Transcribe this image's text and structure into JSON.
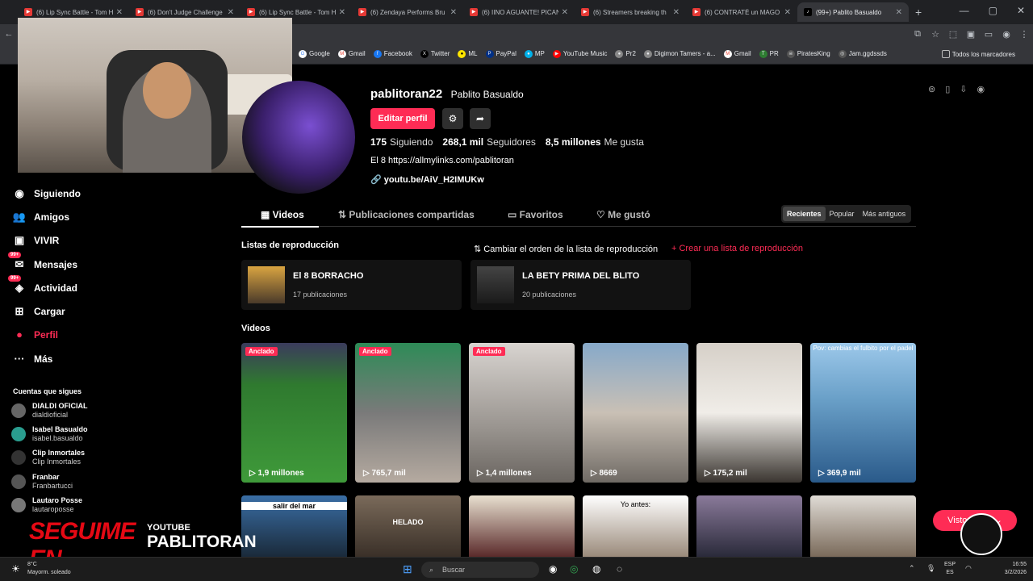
{
  "browser": {
    "tabs": [
      {
        "title": "(6) Lip Sync Battle - Tom H"
      },
      {
        "title": "(6) Don't Judge Challenge"
      },
      {
        "title": "(6) Lip Sync Battle - Tom H"
      },
      {
        "title": "(6) Zendaya Performs Bru"
      },
      {
        "title": "(6) IINO AGUANTE! PICAN"
      },
      {
        "title": "(6) Streamers breaking th"
      },
      {
        "title": "(6) CONTRATÉ un MAGO"
      },
      {
        "title": "(99+) Pablito Basualdo"
      }
    ],
    "bookmarks": [
      "Google",
      "Gmail",
      "Facebook",
      "Twitter",
      "ML",
      "PayPal",
      "MP",
      "YouTube Music",
      "Pr2",
      "Digimon Tamers - a...",
      "Gmail",
      "PR",
      "PiratesKing",
      "Jam.ggdssds"
    ],
    "all_bookmarks": "Todos los marcadores"
  },
  "sidebar": {
    "items": [
      {
        "label": "Siguiendo",
        "icon": "following-icon",
        "badge": ""
      },
      {
        "label": "Amigos",
        "icon": "friends-icon",
        "badge": ""
      },
      {
        "label": "VIVIR",
        "icon": "live-icon",
        "badge": ""
      },
      {
        "label": "Mensajes",
        "icon": "messages-icon",
        "badge": "99+"
      },
      {
        "label": "Actividad",
        "icon": "activity-icon",
        "badge": "99+"
      },
      {
        "label": "Cargar",
        "icon": "upload-icon",
        "badge": ""
      },
      {
        "label": "Perfil",
        "icon": "profile-icon",
        "badge": ""
      },
      {
        "label": "Más",
        "icon": "more-icon",
        "badge": ""
      }
    ],
    "following_title": "Cuentas que sigues",
    "following": [
      {
        "name": "DIALDI OFICIAL",
        "handle": "dialdioficial"
      },
      {
        "name": "Isabel Basualdo",
        "handle": "isabel.basualdo"
      },
      {
        "name": "Clip Inmortales",
        "handle": "Clip Inmortales"
      },
      {
        "name": "Franbar",
        "handle": "Franbartucci"
      },
      {
        "name": "Lautaro Posse",
        "handle": "lautaroposse"
      }
    ]
  },
  "profile": {
    "username": "pablitoran22",
    "nickname": "Pablito Basualdo",
    "edit_label": "Editar perfil",
    "following_count": "175",
    "following_label": "Siguiendo",
    "followers_count": "268,1 mil",
    "followers_label": "Seguidores",
    "likes_count": "8,5 millones",
    "likes_label": "Me gusta",
    "bio": "El 8 https://allmylinks.com/pablitoran",
    "link": "youtu.be/AiV_H2IMUKw"
  },
  "tabs": {
    "videos": "Videos",
    "shared": "Publicaciones compartidas",
    "favorites": "Favoritos",
    "liked": "Me gustó"
  },
  "sort": {
    "recent": "Recientes",
    "popular": "Popular",
    "oldest": "Más antiguos"
  },
  "playlists": {
    "title": "Listas de reproducción",
    "reorder": "Cambiar el orden de la lista de reproducción",
    "create": "Crear una lista de reproducción",
    "items": [
      {
        "name": "El 8 BORRACHO",
        "count": "17 publicaciones"
      },
      {
        "name": "LA BETY PRIMA DEL BLITO",
        "count": "20 publicaciones"
      }
    ]
  },
  "videos": {
    "title": "Videos",
    "row1": [
      {
        "views": "1,9 millones",
        "pinned": "Anclado",
        "caption": ""
      },
      {
        "views": "765,7 mil",
        "pinned": "Anclado",
        "caption": ""
      },
      {
        "views": "1,4 millones",
        "pinned": "Anclado",
        "caption": ""
      },
      {
        "views": "8669",
        "pinned": "",
        "caption": ""
      },
      {
        "views": "175,2 mil",
        "pinned": "",
        "caption": ""
      },
      {
        "views": "369,9 mil",
        "pinned": "",
        "caption": "Pov: cambias el fulbito por el padel"
      }
    ],
    "row2": [
      {
        "caption": "salir del mar"
      },
      {
        "caption": "HELADO"
      },
      {
        "caption": ""
      },
      {
        "caption": "Yo antes:"
      },
      {
        "caption": ""
      },
      {
        "caption": ""
      }
    ]
  },
  "overlay": {
    "follow_text": "SEGUIME EN",
    "platform": "YOUTUBE",
    "channel": "PABLITORAN"
  },
  "visto_label": "Visto ahora",
  "taskbar": {
    "weather_temp": "8°C",
    "weather_desc": "Mayorm. soleado",
    "search": "Buscar",
    "lang1": "ESP",
    "lang2": "ES",
    "time": "16:55",
    "date": "3/2/2026"
  },
  "colors": {
    "accent": "#fe2c55",
    "background": "#000000"
  }
}
